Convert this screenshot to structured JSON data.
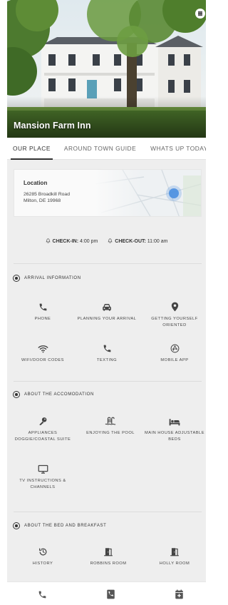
{
  "hero": {
    "title": "Mansion Farm Inn",
    "menu_icon": "menu-dots-icon"
  },
  "tabs": [
    {
      "label": "OUR PLACE",
      "active": true
    },
    {
      "label": "AROUND TOWN GUIDE",
      "active": false
    },
    {
      "label": "WHATS UP TODAY",
      "active": false
    }
  ],
  "location": {
    "label": "Location",
    "address_line1": "26285 Broadkill Road",
    "address_line2": "Milton, DE 19968"
  },
  "checkin": {
    "checkin_label": "CHECK-IN:",
    "checkin_time": "4:00 pm",
    "checkout_label": "CHECK-OUT:",
    "checkout_time": "11:00 am"
  },
  "sections": [
    {
      "title": "ARRIVAL INFORMATION",
      "items": [
        {
          "label": "PHONE",
          "icon": "phone-icon"
        },
        {
          "label": "PLANNING YOUR ARRIVAL",
          "icon": "car-icon"
        },
        {
          "label": "GETTING YOURSELF ORIENTED",
          "icon": "map-pin-icon"
        },
        {
          "label": "WIFI/DOOR CODES",
          "icon": "wifi-icon"
        },
        {
          "label": "TEXTING",
          "icon": "phone-icon"
        },
        {
          "label": "MOBILE APP",
          "icon": "app-store-icon"
        }
      ]
    },
    {
      "title": "ABOUT THE ACCOMODATION",
      "items": [
        {
          "label": "APPLIANCES DOGGIE/COASTAL SUITE",
          "icon": "key-icon"
        },
        {
          "label": "ENJOYING THE POOL",
          "icon": "pool-ladder-icon"
        },
        {
          "label": "MAIN HOUSE ADJUSTABLE BEDS",
          "icon": "bed-icon"
        },
        {
          "label": "TV INSTRUCTIONS & CHANNELS",
          "icon": "tv-icon"
        }
      ]
    },
    {
      "title": "ABOUT THE BED AND BREAKFAST",
      "items": [
        {
          "label": "HISTORY",
          "icon": "history-icon"
        },
        {
          "label": "ROBBINS ROOM",
          "icon": "door-icon"
        },
        {
          "label": "HOLLY ROOM",
          "icon": "door-icon"
        }
      ]
    }
  ],
  "bottom_nav": [
    {
      "icon": "phone-icon"
    },
    {
      "icon": "phone-book-icon"
    },
    {
      "icon": "calendar-add-icon"
    }
  ],
  "colors": {
    "icon": "#444444",
    "background": "#eeeeee",
    "map_dot": "#4a8fe0"
  }
}
